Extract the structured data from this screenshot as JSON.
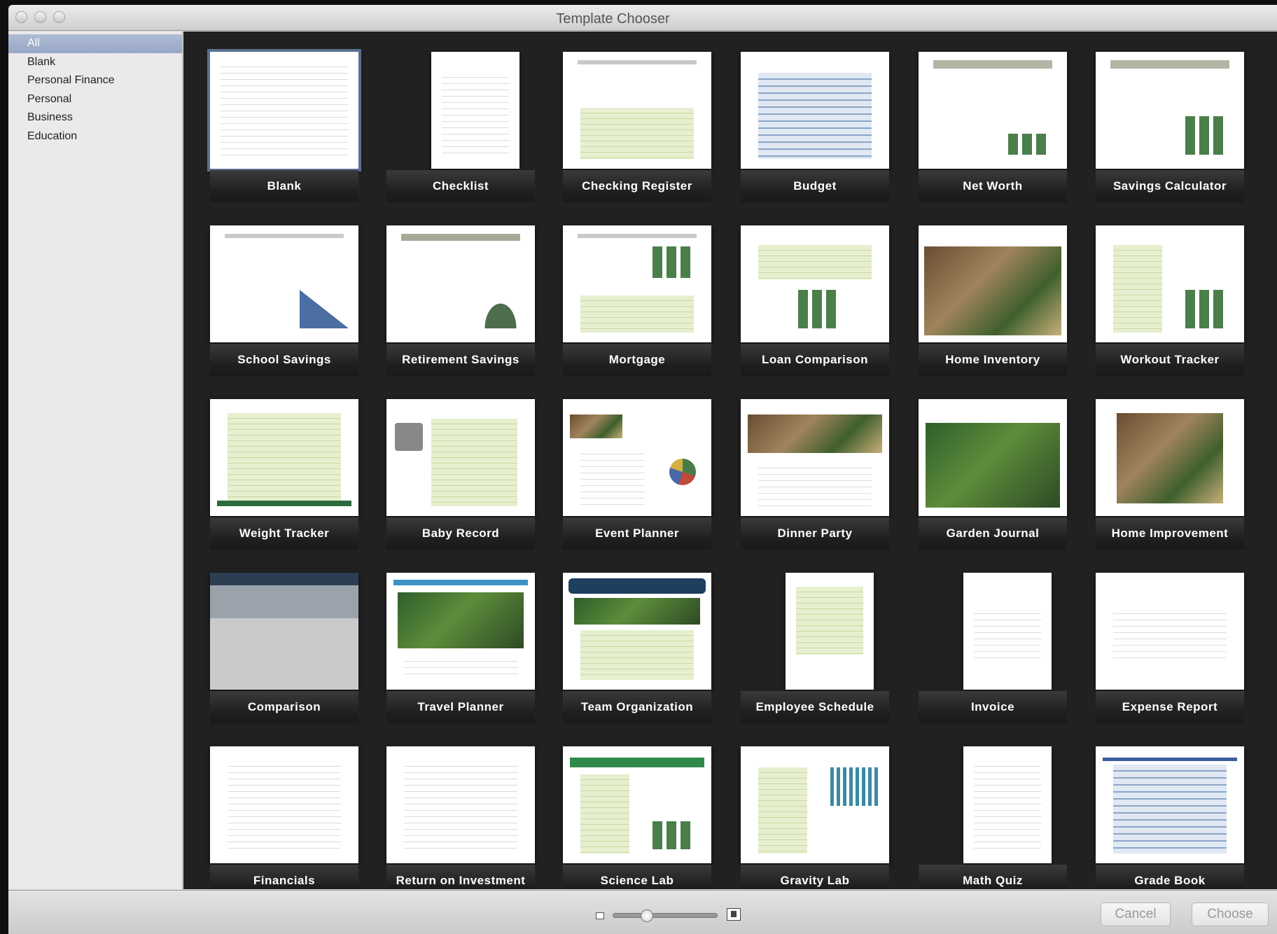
{
  "window": {
    "title": "Template Chooser"
  },
  "sidebar": {
    "items": [
      {
        "label": "All",
        "selected": true
      },
      {
        "label": "Blank"
      },
      {
        "label": "Personal Finance"
      },
      {
        "label": "Personal"
      },
      {
        "label": "Business"
      },
      {
        "label": "Education"
      }
    ]
  },
  "templates": [
    {
      "label": "Blank",
      "selected": true
    },
    {
      "label": "Checklist"
    },
    {
      "label": "Checking Register"
    },
    {
      "label": "Budget"
    },
    {
      "label": "Net Worth"
    },
    {
      "label": "Savings Calculator"
    },
    {
      "label": "School Savings"
    },
    {
      "label": "Retirement Savings"
    },
    {
      "label": "Mortgage"
    },
    {
      "label": "Loan Comparison"
    },
    {
      "label": "Home Inventory"
    },
    {
      "label": "Workout Tracker"
    },
    {
      "label": "Weight Tracker"
    },
    {
      "label": "Baby Record"
    },
    {
      "label": "Event Planner"
    },
    {
      "label": "Dinner Party"
    },
    {
      "label": "Garden Journal"
    },
    {
      "label": "Home Improvement"
    },
    {
      "label": "Comparison"
    },
    {
      "label": "Travel Planner"
    },
    {
      "label": "Team Organization"
    },
    {
      "label": "Employee Schedule"
    },
    {
      "label": "Invoice"
    },
    {
      "label": "Expense Report"
    },
    {
      "label": "Financials"
    },
    {
      "label": "Return on Investment"
    },
    {
      "label": "Science Lab"
    },
    {
      "label": "Gravity Lab"
    },
    {
      "label": "Math Quiz"
    },
    {
      "label": "Grade Book"
    }
  ],
  "footer": {
    "zoom_level": 0.3,
    "cancel_label": "Cancel",
    "choose_label": "Choose"
  }
}
